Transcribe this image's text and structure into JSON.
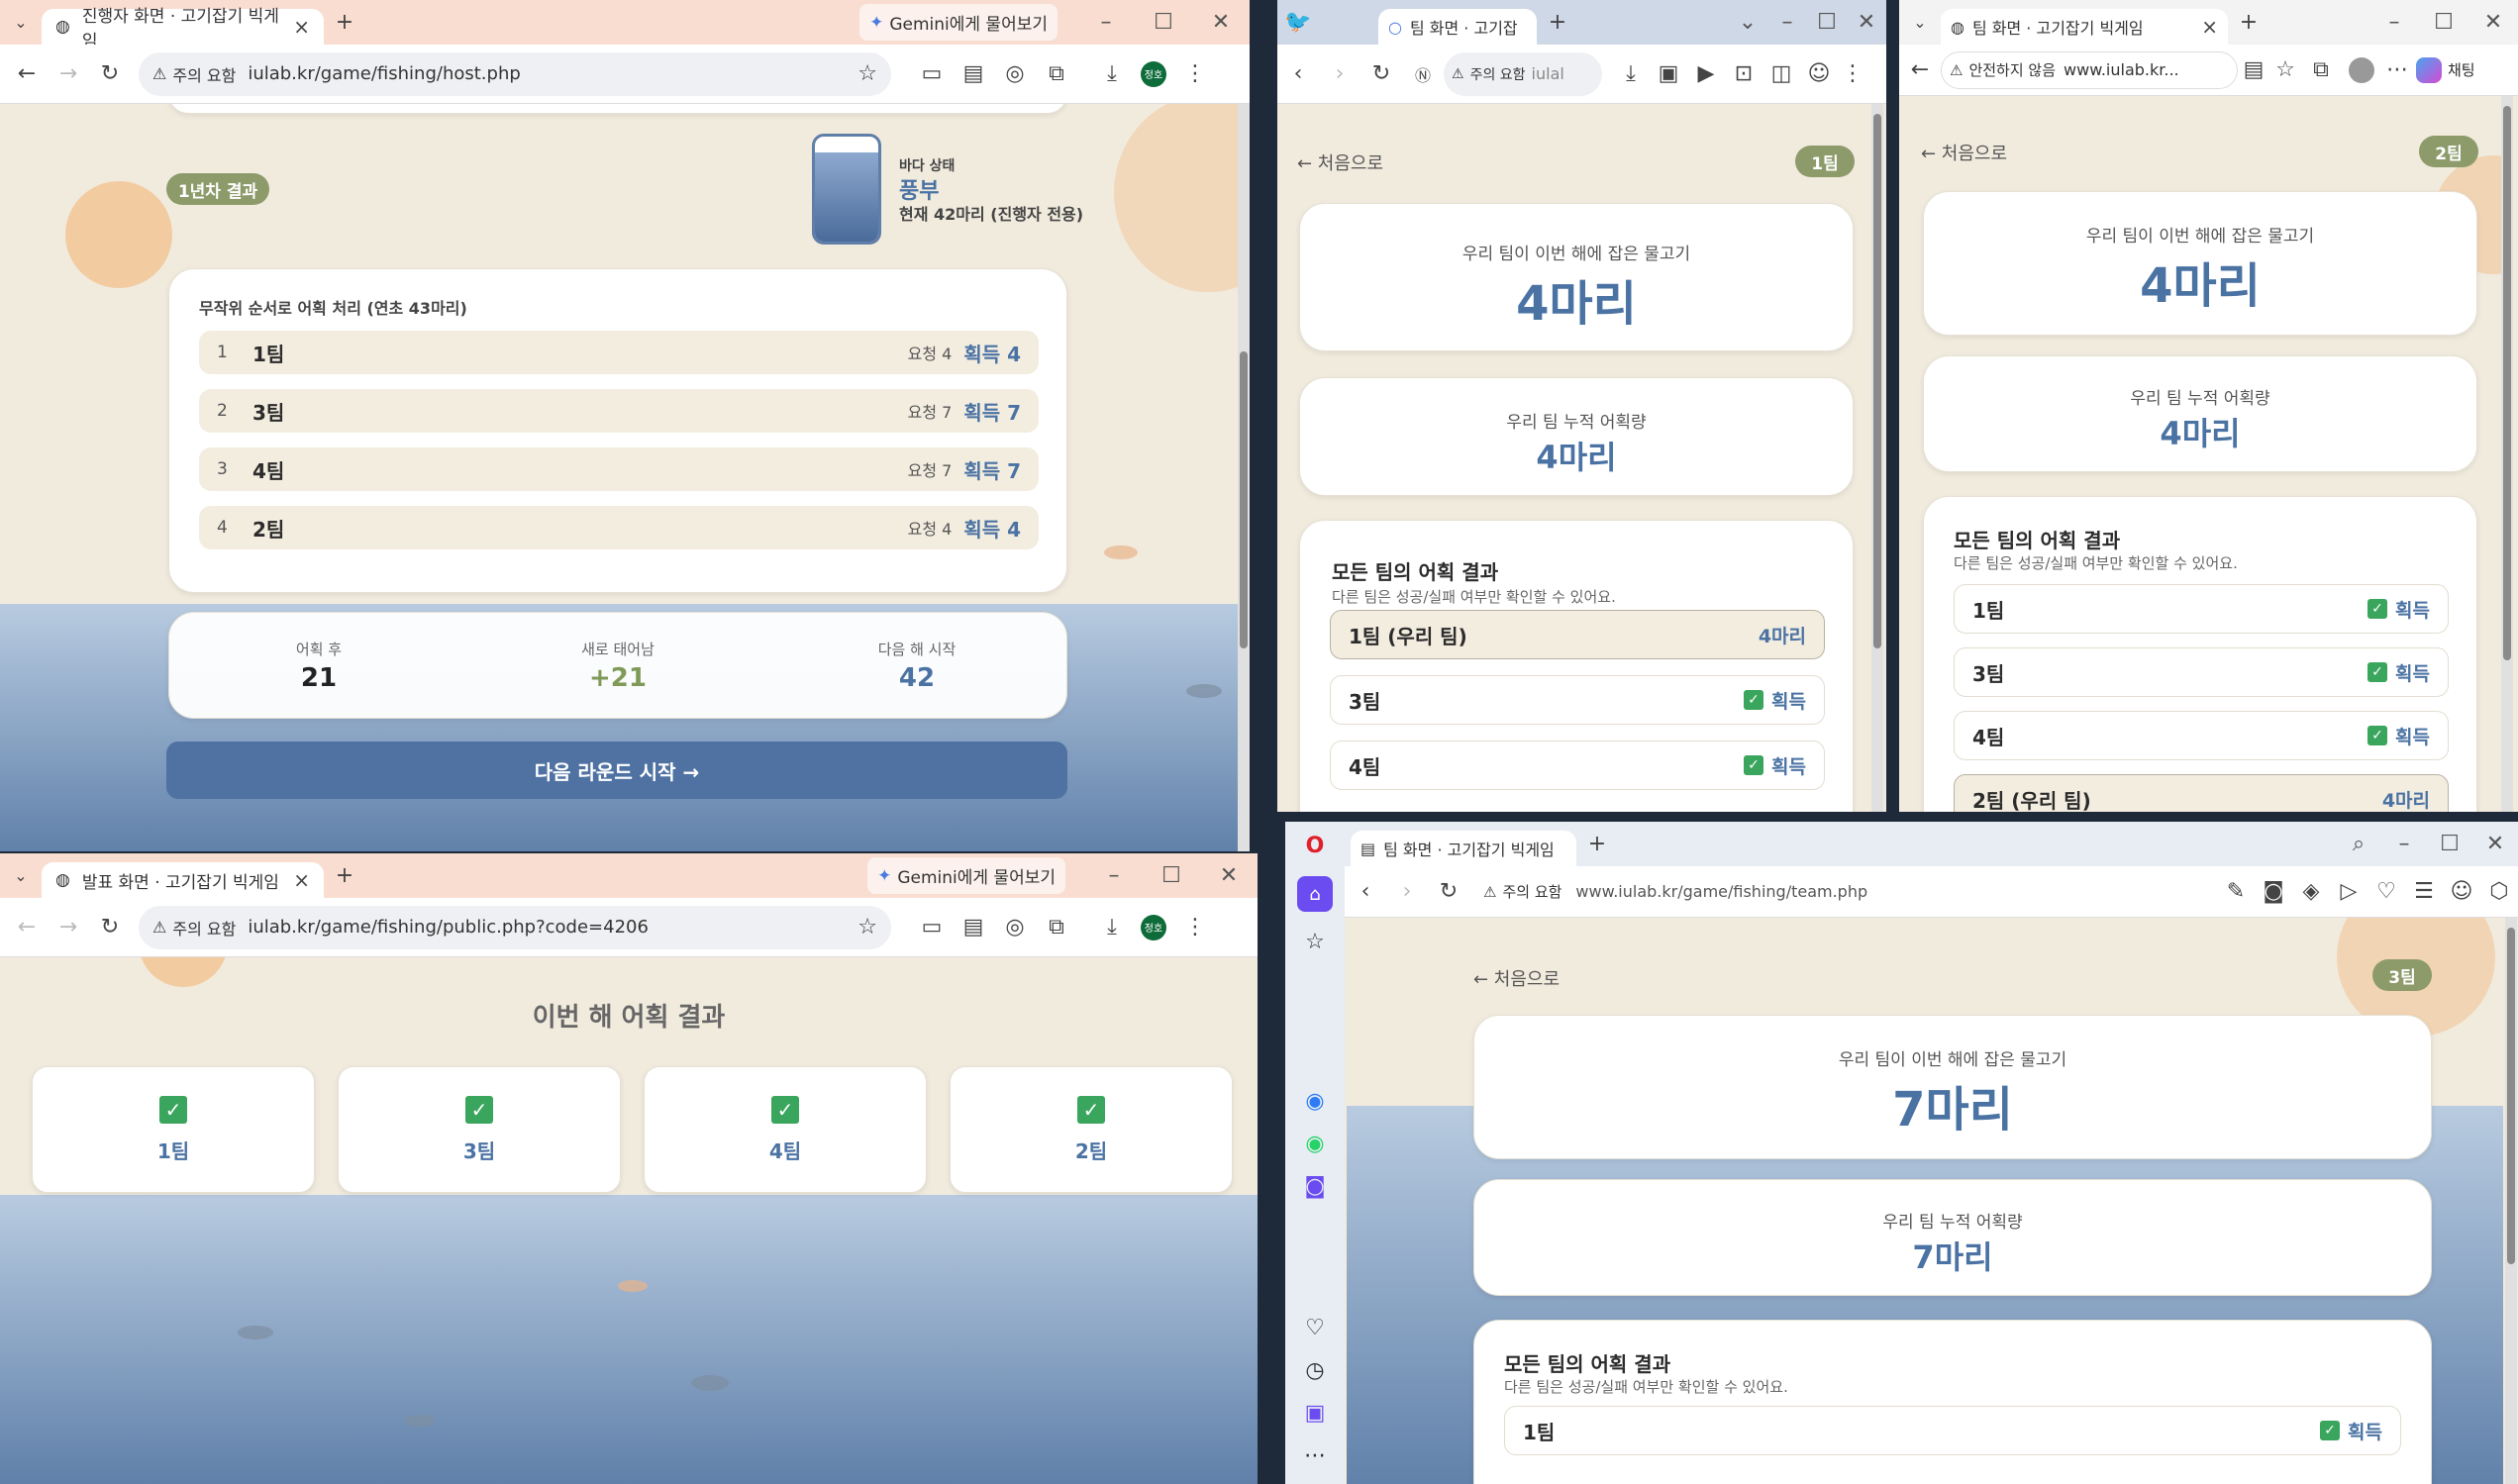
{
  "host": {
    "tab_title": "진행자 화면 · 고기잡기 빅게임",
    "gemini": "Gemini에게 물어보기",
    "warn": "주의 요함",
    "url": "iulab.kr/game/fishing/host.php",
    "profile": "정호",
    "round_badge": "1년차 결과",
    "sea_label": "바다 상태",
    "sea_status": "풍부",
    "sea_count": "현재 42마리 (진행자 전용)",
    "sea_level_fraction": 0.85,
    "process_title": "무작위 순서로 어획 처리 (연초 43마리)",
    "rows": [
      {
        "idx": "1",
        "team": "1팀",
        "req": "요청 4",
        "got": "획득 4"
      },
      {
        "idx": "2",
        "team": "3팀",
        "req": "요청 7",
        "got": "획득 7"
      },
      {
        "idx": "3",
        "team": "4팀",
        "req": "요청 7",
        "got": "획득 7"
      },
      {
        "idx": "4",
        "team": "2팀",
        "req": "요청 4",
        "got": "획득 4"
      }
    ],
    "stats": [
      {
        "label": "어획 후",
        "value": "21"
      },
      {
        "label": "새로 태어남",
        "value": "+21"
      },
      {
        "label": "다음 해 시작",
        "value": "42"
      }
    ],
    "next_button": "다음 라운드 시작 →"
  },
  "public": {
    "tab_title": "발표 화면 · 고기잡기 빅게임",
    "gemini": "Gemini에게 물어보기",
    "warn": "주의 요함",
    "url": "iulab.kr/game/fishing/public.php?code=4206",
    "profile": "정호",
    "title": "이번 해 어획 결과",
    "teams": [
      "1팀",
      "3팀",
      "4팀",
      "2팀"
    ]
  },
  "team1": {
    "tab_title": "팀 화면 · 고기잡",
    "warn": "주의 요함",
    "url": "iulal",
    "back": "← 처음으로",
    "badge": "1팀",
    "catch_label": "우리 팀이 이번 해에 잡은 물고기",
    "catch_value": "4마리",
    "total_label": "우리 팀 누적 어획량",
    "total_value": "4마리",
    "all_title": "모든 팀의 어획 결과",
    "all_sub": "다른 팀은 성공/실패 여부만 확인할 수 있어요.",
    "rows": [
      {
        "team": "1팀 (우리 팀)",
        "result": "4마리",
        "own": true
      },
      {
        "team": "3팀",
        "result": "획득",
        "own": false
      },
      {
        "team": "4팀",
        "result": "획득",
        "own": false
      }
    ]
  },
  "team2": {
    "tab_title": "팀 화면 · 고기잡기 빅게임",
    "warn": "안전하지 않음",
    "url": "www.iulab.kr...",
    "chat": "채팅",
    "back": "← 처음으로",
    "badge": "2팀",
    "catch_label": "우리 팀이 이번 해에 잡은 물고기",
    "catch_value": "4마리",
    "total_label": "우리 팀 누적 어획량",
    "total_value": "4마리",
    "all_title": "모든 팀의 어획 결과",
    "all_sub": "다른 팀은 성공/실패 여부만 확인할 수 있어요.",
    "rows": [
      {
        "team": "1팀",
        "result": "획득",
        "own": false
      },
      {
        "team": "3팀",
        "result": "획득",
        "own": false
      },
      {
        "team": "4팀",
        "result": "획득",
        "own": false
      },
      {
        "team": "2팀 (우리 팀)",
        "result": "4마리",
        "own": true
      }
    ]
  },
  "team3": {
    "tab_title": "팀 화면 · 고기잡기 빅게임",
    "warn": "주의 요함",
    "url": "www.iulab.kr/game/fishing/team.php",
    "back": "← 처음으로",
    "badge": "3팀",
    "catch_label": "우리 팀이 이번 해에 잡은 물고기",
    "catch_value": "7마리",
    "total_label": "우리 팀 누적 어획량",
    "total_value": "7마리",
    "all_title": "모든 팀의 어획 결과",
    "all_sub": "다른 팀은 성공/실패 여부만 확인할 수 있어요.",
    "rows": [
      {
        "team": "1팀",
        "result": "획득",
        "own": false
      }
    ]
  },
  "colors": {
    "accent": "#4a72a3",
    "badge": "#8d9a6a",
    "check": "#3aa55d",
    "button": "#4f72a3"
  }
}
